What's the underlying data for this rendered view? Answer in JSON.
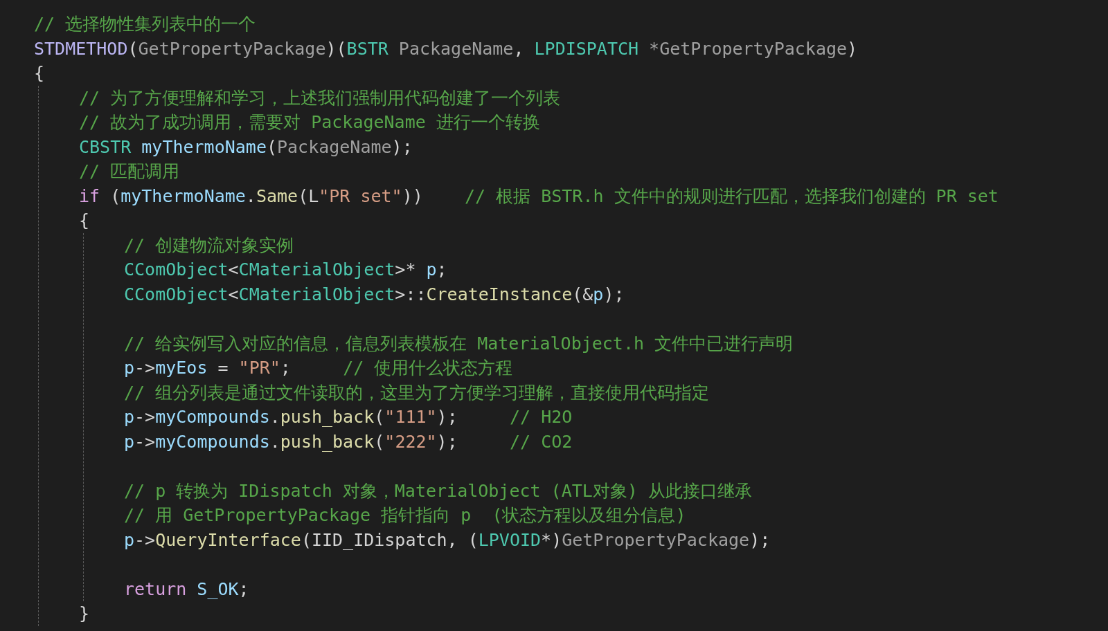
{
  "code": [
    {
      "kind": "line",
      "tokens": [
        {
          "kind": "comment",
          "text": "// 选择物性集列表中的一个"
        }
      ]
    },
    {
      "kind": "line",
      "tokens": [
        {
          "kind": "macro",
          "text": "STDMETHOD"
        },
        {
          "kind": "punct",
          "text": "("
        },
        {
          "kind": "param",
          "text": "GetPropertyPackage"
        },
        {
          "kind": "punct",
          "text": ")("
        },
        {
          "kind": "type",
          "text": "BSTR"
        },
        {
          "kind": "param",
          "text": " PackageName"
        },
        {
          "kind": "punct",
          "text": ", "
        },
        {
          "kind": "type",
          "text": "LPDISPATCH"
        },
        {
          "kind": "param",
          "text": " *GetPropertyPackage"
        },
        {
          "kind": "punct",
          "text": ")"
        }
      ]
    },
    {
      "kind": "line",
      "tokens": [
        {
          "kind": "punct",
          "text": "{"
        }
      ]
    },
    {
      "kind": "block",
      "children": [
        {
          "kind": "line",
          "tokens": [
            {
              "kind": "comment",
              "text": "// 为了方便理解和学习，上述我们强制用代码创建了一个列表"
            }
          ]
        },
        {
          "kind": "line",
          "tokens": [
            {
              "kind": "comment",
              "text": "// 故为了成功调用，需要对 PackageName 进行一个转换"
            }
          ]
        },
        {
          "kind": "line",
          "tokens": [
            {
              "kind": "type",
              "text": "CBSTR"
            },
            {
              "kind": "var",
              "text": " myThermoName"
            },
            {
              "kind": "punct",
              "text": "("
            },
            {
              "kind": "param",
              "text": "PackageName"
            },
            {
              "kind": "punct",
              "text": ");"
            }
          ]
        },
        {
          "kind": "line",
          "tokens": [
            {
              "kind": "comment",
              "text": "// 匹配调用"
            }
          ]
        },
        {
          "kind": "line",
          "tokens": [
            {
              "kind": "keyword",
              "text": "if"
            },
            {
              "kind": "punct",
              "text": " ("
            },
            {
              "kind": "var",
              "text": "myThermoName"
            },
            {
              "kind": "punct",
              "text": "."
            },
            {
              "kind": "func",
              "text": "Same"
            },
            {
              "kind": "punct",
              "text": "(L"
            },
            {
              "kind": "string",
              "text": "\"PR set\""
            },
            {
              "kind": "punct",
              "text": "))"
            },
            {
              "kind": "comment",
              "text": "    // 根据 BSTR.h 文件中的规则进行匹配，选择我们创建的 PR set"
            }
          ]
        },
        {
          "kind": "line",
          "tokens": [
            {
              "kind": "punct",
              "text": "{"
            }
          ]
        },
        {
          "kind": "block",
          "children": [
            {
              "kind": "line",
              "tokens": [
                {
                  "kind": "comment",
                  "text": "// 创建物流对象实例"
                }
              ]
            },
            {
              "kind": "line",
              "tokens": [
                {
                  "kind": "type",
                  "text": "CComObject"
                },
                {
                  "kind": "punct",
                  "text": "<"
                },
                {
                  "kind": "type",
                  "text": "CMaterialObject"
                },
                {
                  "kind": "punct",
                  "text": ">* "
                },
                {
                  "kind": "var",
                  "text": "p"
                },
                {
                  "kind": "punct",
                  "text": ";"
                }
              ]
            },
            {
              "kind": "line",
              "tokens": [
                {
                  "kind": "type",
                  "text": "CComObject"
                },
                {
                  "kind": "punct",
                  "text": "<"
                },
                {
                  "kind": "type",
                  "text": "CMaterialObject"
                },
                {
                  "kind": "punct",
                  "text": ">::"
                },
                {
                  "kind": "func",
                  "text": "CreateInstance"
                },
                {
                  "kind": "punct",
                  "text": "(&"
                },
                {
                  "kind": "var",
                  "text": "p"
                },
                {
                  "kind": "punct",
                  "text": ");"
                }
              ]
            },
            {
              "kind": "blank"
            },
            {
              "kind": "line",
              "tokens": [
                {
                  "kind": "comment",
                  "text": "// 给实例写入对应的信息，信息列表模板在 MaterialObject.h 文件中已进行声明"
                }
              ]
            },
            {
              "kind": "line",
              "tokens": [
                {
                  "kind": "var",
                  "text": "p"
                },
                {
                  "kind": "punct",
                  "text": "->"
                },
                {
                  "kind": "var",
                  "text": "myEos"
                },
                {
                  "kind": "punct",
                  "text": " = "
                },
                {
                  "kind": "string",
                  "text": "\"PR\""
                },
                {
                  "kind": "punct",
                  "text": ";"
                },
                {
                  "kind": "comment",
                  "text": "     // 使用什么状态方程"
                }
              ]
            },
            {
              "kind": "line",
              "tokens": [
                {
                  "kind": "comment",
                  "text": "// 组分列表是通过文件读取的，这里为了方便学习理解，直接使用代码指定"
                }
              ]
            },
            {
              "kind": "line",
              "tokens": [
                {
                  "kind": "var",
                  "text": "p"
                },
                {
                  "kind": "punct",
                  "text": "->"
                },
                {
                  "kind": "var",
                  "text": "myCompounds"
                },
                {
                  "kind": "punct",
                  "text": "."
                },
                {
                  "kind": "func",
                  "text": "push_back"
                },
                {
                  "kind": "punct",
                  "text": "("
                },
                {
                  "kind": "string",
                  "text": "\"111\""
                },
                {
                  "kind": "punct",
                  "text": ");"
                },
                {
                  "kind": "comment",
                  "text": "     // H2O"
                }
              ]
            },
            {
              "kind": "line",
              "tokens": [
                {
                  "kind": "var",
                  "text": "p"
                },
                {
                  "kind": "punct",
                  "text": "->"
                },
                {
                  "kind": "var",
                  "text": "myCompounds"
                },
                {
                  "kind": "punct",
                  "text": "."
                },
                {
                  "kind": "func",
                  "text": "push_back"
                },
                {
                  "kind": "punct",
                  "text": "("
                },
                {
                  "kind": "string",
                  "text": "\"222\""
                },
                {
                  "kind": "punct",
                  "text": ");"
                },
                {
                  "kind": "comment",
                  "text": "     // CO2"
                }
              ]
            },
            {
              "kind": "blank"
            },
            {
              "kind": "line",
              "tokens": [
                {
                  "kind": "comment",
                  "text": "// p 转换为 IDispatch 对象，MaterialObject (ATL对象) 从此接口继承"
                }
              ]
            },
            {
              "kind": "line",
              "tokens": [
                {
                  "kind": "comment",
                  "text": "// 用 GetPropertyPackage 指针指向 p  (状态方程以及组分信息)"
                }
              ]
            },
            {
              "kind": "line",
              "tokens": [
                {
                  "kind": "var",
                  "text": "p"
                },
                {
                  "kind": "punct",
                  "text": "->"
                },
                {
                  "kind": "func",
                  "text": "QueryInterface"
                },
                {
                  "kind": "punct",
                  "text": "(IID_IDispatch, ("
                },
                {
                  "kind": "type",
                  "text": "LPVOID"
                },
                {
                  "kind": "punct",
                  "text": "*)"
                },
                {
                  "kind": "param",
                  "text": "GetPropertyPackage"
                },
                {
                  "kind": "punct",
                  "text": ");"
                }
              ]
            },
            {
              "kind": "blank"
            },
            {
              "kind": "line",
              "tokens": [
                {
                  "kind": "keyword",
                  "text": "return"
                },
                {
                  "kind": "var",
                  "text": " S_OK"
                },
                {
                  "kind": "punct",
                  "text": ";"
                }
              ]
            }
          ]
        },
        {
          "kind": "line",
          "tokens": [
            {
              "kind": "punct",
              "text": "}"
            }
          ]
        }
      ]
    }
  ]
}
